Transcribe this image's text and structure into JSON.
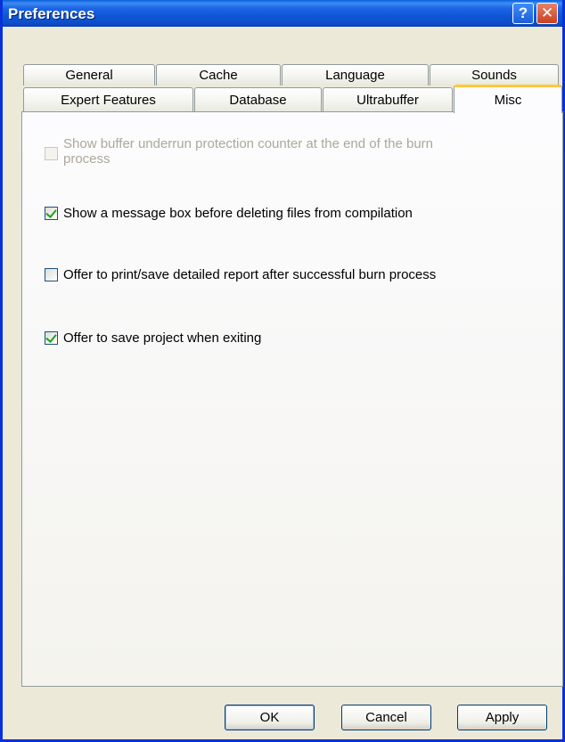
{
  "window": {
    "title": "Preferences",
    "help_glyph": "?",
    "close_glyph": "✕"
  },
  "tabs_row1": [
    {
      "label": "General"
    },
    {
      "label": "Cache"
    },
    {
      "label": "Language"
    },
    {
      "label": "Sounds"
    }
  ],
  "tabs_row2": [
    {
      "label": "Expert Features"
    },
    {
      "label": "Database"
    },
    {
      "label": "Ultrabuffer"
    },
    {
      "label": "Misc"
    }
  ],
  "selected_tab": "Misc",
  "options": [
    {
      "label_line1": "Show buffer underrun protection counter at the end of the burn",
      "label_line2": "process",
      "checked": false,
      "enabled": false
    },
    {
      "label_line1": "Show a message box before deleting files from compilation",
      "checked": true,
      "enabled": true
    },
    {
      "label_line1": "Offer to print/save detailed report after successful burn process",
      "checked": false,
      "enabled": true
    },
    {
      "label_line1": "Offer to save project when exiting",
      "checked": true,
      "enabled": true
    }
  ],
  "buttons": {
    "ok": "OK",
    "cancel": "Cancel",
    "apply": "Apply"
  }
}
